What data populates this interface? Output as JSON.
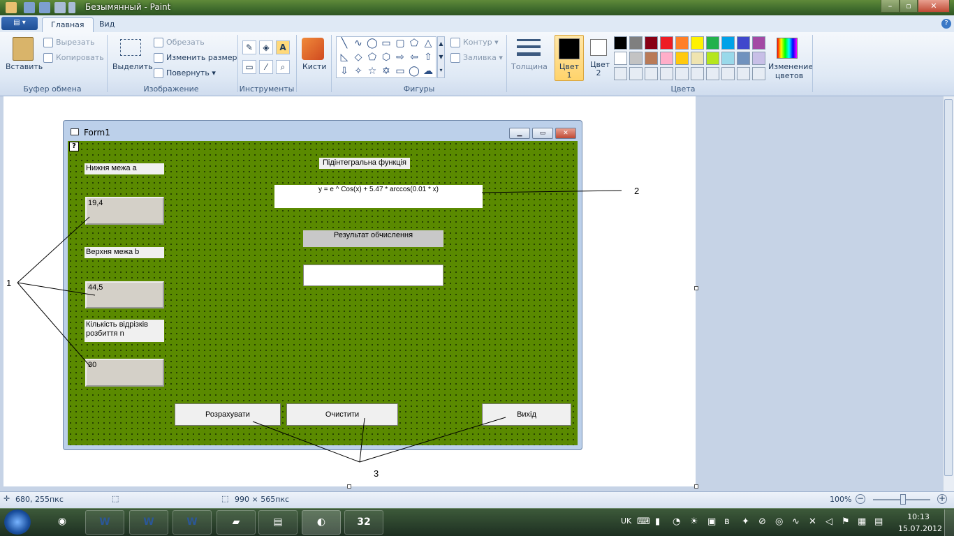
{
  "window": {
    "title": "Безымянный - Paint"
  },
  "tabs": [
    {
      "label": "Главная"
    },
    {
      "label": "Вид"
    }
  ],
  "clipboard": {
    "paste": "Вставить",
    "cut": "Вырезать",
    "copy": "Копировать",
    "group": "Буфер обмена"
  },
  "image": {
    "select": "Выделить",
    "crop": "Обрезать",
    "resize": "Изменить размер",
    "rotate": "Повернуть",
    "group": "Изображение"
  },
  "tools": {
    "group": "Инструменты",
    "text_tool": "A"
  },
  "brushes": {
    "label": "Кисти"
  },
  "shapes": {
    "outline": "Контур",
    "fill": "Заливка",
    "group": "Фигуры"
  },
  "thickness": {
    "label": "Толщина"
  },
  "colors": {
    "color1": "Цвет 1",
    "color2": "Цвет 2",
    "edit": "Изменение цветов",
    "group": "Цвета",
    "palette_row1": [
      "#000000",
      "#7f7f7f",
      "#880015",
      "#ed1c24",
      "#ff7f27",
      "#fff200",
      "#22b14c",
      "#00a2e8",
      "#3f48cc",
      "#a349a4"
    ],
    "palette_row2": [
      "#ffffff",
      "#c3c3c3",
      "#b97a57",
      "#ffaec9",
      "#ffc90e",
      "#efe4b0",
      "#b5e61d",
      "#99d9ea",
      "#7092be",
      "#c8bfe7"
    ]
  },
  "form": {
    "title": "Form1",
    "label_a": "Нижня межа а",
    "value_a": "19,4",
    "label_b": "Верхня межа b",
    "value_b": "44,5",
    "label_n1": "Кількість відрізків",
    "label_n2": "розбиття n",
    "value_n": "30",
    "label_func": "Підінтегральна функція",
    "formula": "y = e ^ Cos(x) + 5.47 * arccos(0.01 * x)",
    "label_result": "Результат обчислення",
    "result": "",
    "btn_calc": "Розрахувати",
    "btn_clear": "Очистити",
    "btn_exit": "Вихід"
  },
  "annotations": {
    "a1": "1",
    "a2": "2",
    "a3": "3"
  },
  "status": {
    "cursor": "680, 255пкс",
    "size": "990 × 565пкс",
    "zoom": "100%"
  },
  "tray": {
    "lang": "UK",
    "time": "10:13",
    "date": "15.07.2012"
  },
  "taskbar": {
    "items": [
      "W",
      "W",
      "W",
      "",
      "",
      "",
      "32"
    ]
  }
}
